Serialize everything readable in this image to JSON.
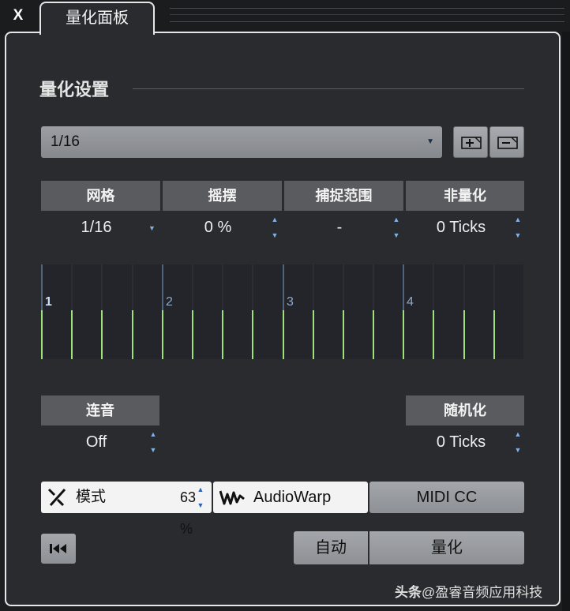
{
  "window": {
    "close_label": "X",
    "tab_title": "量化面板"
  },
  "section": {
    "title": "量化设置"
  },
  "preset": {
    "value": "1/16",
    "add_icon": "add-preset-icon",
    "remove_icon": "remove-preset-icon"
  },
  "params": [
    {
      "label": "网格",
      "value": "1/16",
      "control": "dropdown"
    },
    {
      "label": "摇摆",
      "value": "0 %",
      "control": "stepper"
    },
    {
      "label": "捕捉范围",
      "value": "-",
      "control": "stepper"
    },
    {
      "label": "非量化",
      "value": "0 Ticks",
      "control": "stepper"
    }
  ],
  "grid": {
    "bar_labels": [
      "1",
      "2",
      "3",
      "4"
    ],
    "beats_per_bar": 4,
    "subdivisions_per_beat": 4,
    "line_color": "#9fe07a",
    "beat_line_color": "#6e8fb3"
  },
  "legato": {
    "label": "连音",
    "value": "Off"
  },
  "randomize": {
    "label": "随机化",
    "value": "0 Ticks"
  },
  "mode": {
    "label": "模式",
    "value": "63 %"
  },
  "buttons": {
    "audiowarp": "AudioWarp",
    "midi_cc": "MIDI CC",
    "auto": "自动",
    "quantize": "量化"
  },
  "watermark": {
    "brand": "头条",
    "text": "@盈睿音频应用科技"
  },
  "colors": {
    "panel_bg": "#2a2b2e",
    "header_bg": "#5a5b5e",
    "accent_blue": "#7fb0e8"
  }
}
